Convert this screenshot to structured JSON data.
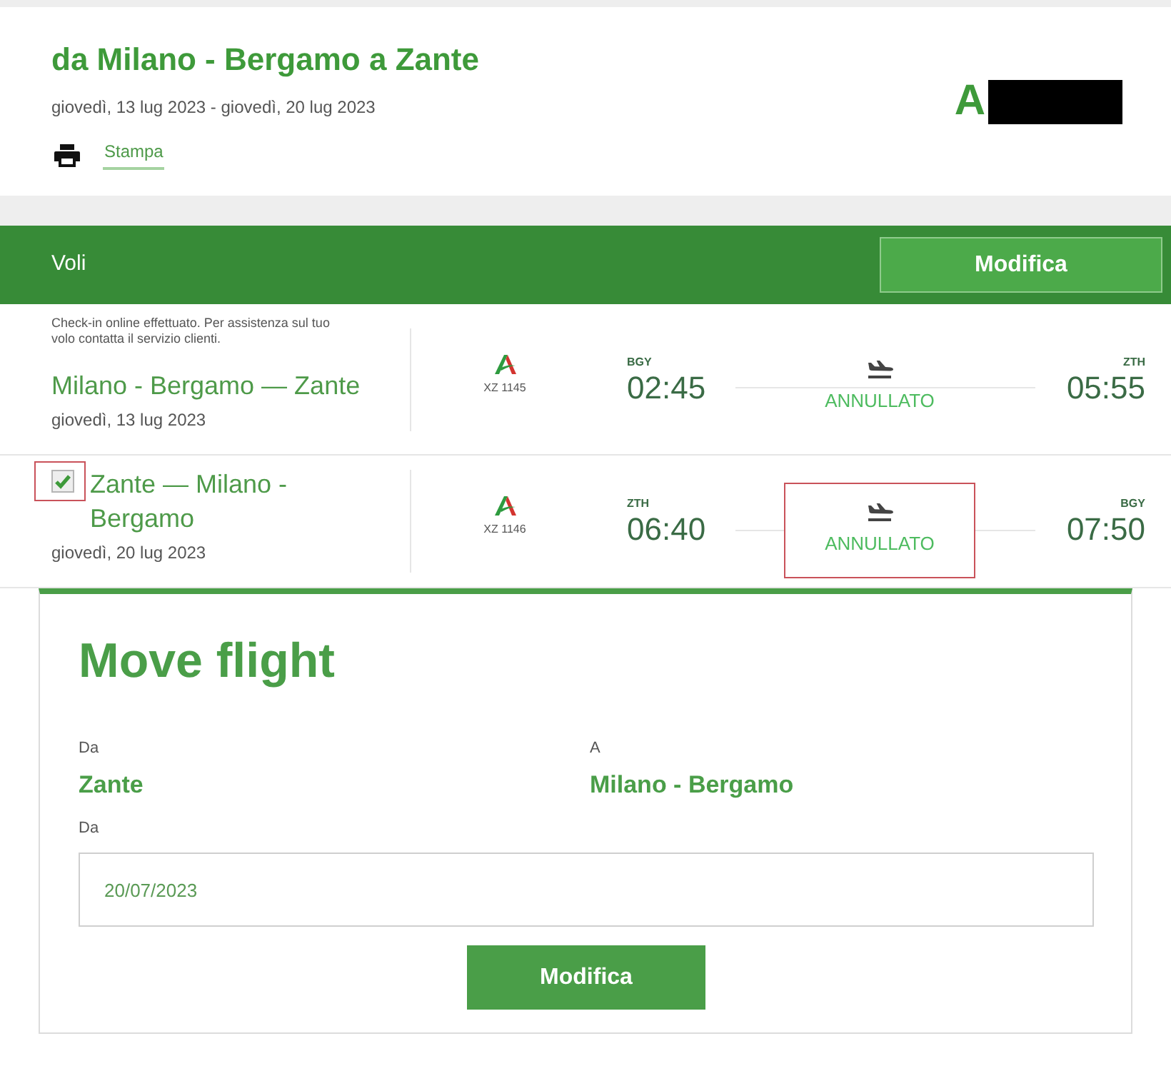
{
  "header": {
    "title": "da Milano - Bergamo a Zante",
    "dates": "giovedì, 13 lug 2023 - giovedì, 20 lug 2023",
    "print_link": "Stampa",
    "booking_code": "A",
    "booking_code_redacted": true
  },
  "flights_section": {
    "title": "Voli",
    "edit_button": "Modifica"
  },
  "flights": [
    {
      "notice": "Check-in online effettuato. Per assistenza sul tuo volo contatta il servizio clienti.",
      "route": "Milano - Bergamo — Zante",
      "date": "giovedì, 13 lug 2023",
      "flight_number": "XZ 1145",
      "departure": {
        "code": "BGY",
        "time": "02:45"
      },
      "arrival": {
        "code": "ZTH",
        "time": "05:55"
      },
      "status": "ANNULLATO",
      "status_highlighted": false
    },
    {
      "checkbox": {
        "checked": true,
        "highlighted": true
      },
      "route": "Zante — Milano - Bergamo",
      "date": "giovedì, 20 lug 2023",
      "flight_number": "XZ 1146",
      "departure": {
        "code": "ZTH",
        "time": "06:40"
      },
      "arrival": {
        "code": "BGY",
        "time": "07:50"
      },
      "status": "ANNULLATO",
      "status_highlighted": true
    }
  ],
  "move_flight": {
    "title": "Move flight",
    "from_label": "Da",
    "from": "Zante",
    "to_label": "A",
    "to": "Milano - Bergamo",
    "date_label": "Da",
    "date_value": "20/07/2023",
    "submit_button": "Modifica"
  }
}
